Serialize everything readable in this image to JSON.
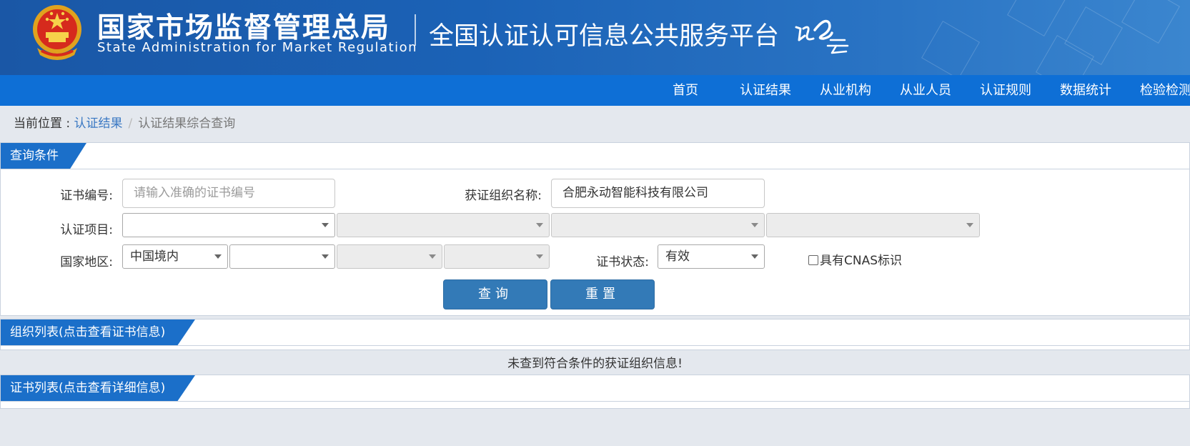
{
  "header": {
    "org_cn": "国家市场监督管理总局",
    "org_en": "State Administration  for  Market Regulation",
    "platform_title": "全国认证认可信息公共服务平台",
    "logo_text": "认e云"
  },
  "nav": {
    "items": [
      "首页",
      "认证结果",
      "从业机构",
      "从业人员",
      "认证规则",
      "数据统计",
      "检验检测"
    ]
  },
  "breadcrumb": {
    "prefix": "当前位置 : ",
    "link": "认证结果",
    "separator": "/",
    "current": "认证结果综合查询"
  },
  "query_panel": {
    "title": "查询条件",
    "cert_no_label": "证书编号:",
    "cert_no_placeholder": "请输入准确的证书编号",
    "org_name_label": "获证组织名称:",
    "org_name_value": "合肥永动智能科技有限公司",
    "project_label": "认证项目:",
    "region_label": "国家地区:",
    "region_value": "中国境内",
    "status_label": "证书状态:",
    "status_value": "有效",
    "cnas_label": "具有CNAS标识",
    "search_button": "查询",
    "reset_button": "重置"
  },
  "org_list": {
    "title": "组织列表(点击查看证书信息)",
    "empty_message": "未查到符合条件的获证组织信息!"
  },
  "cert_list": {
    "title": "证书列表(点击查看详细信息)"
  },
  "colors": {
    "header_blue": "#1b5fb3",
    "nav_blue": "#0e6fd6",
    "tab_blue": "#1b6fc9",
    "button_blue": "#337ab7",
    "link_blue": "#3a78c3"
  }
}
